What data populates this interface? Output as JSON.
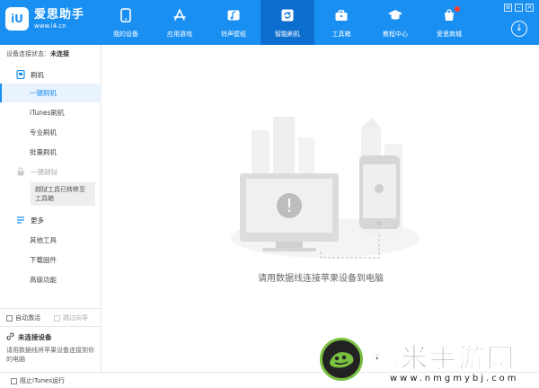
{
  "app": {
    "logo_text": "iU",
    "name": "爱思助手",
    "url": "www.i4.cn"
  },
  "nav": {
    "items": [
      {
        "label": "我的设备",
        "icon": "phone-icon"
      },
      {
        "label": "应用游戏",
        "icon": "app-store-icon"
      },
      {
        "label": "铃声壁纸",
        "icon": "ringtone-wallpaper-icon"
      },
      {
        "label": "智能刷机",
        "icon": "flash-icon",
        "active": true
      },
      {
        "label": "工具箱",
        "icon": "toolbox-icon"
      },
      {
        "label": "教程中心",
        "icon": "graduation-cap-icon"
      },
      {
        "label": "爱思商城",
        "icon": "store-icon",
        "badge": true
      }
    ]
  },
  "window": {
    "menu_glyph": "≡",
    "minimize_glyph": "–",
    "close_glyph": "×",
    "download_glyph": "↓"
  },
  "sidebar": {
    "status_label": "设备连接状态：",
    "status_value": "未连接",
    "flash_section": "刷机",
    "flash_items": [
      "一键刷机",
      "iTunes刷机",
      "专业刷机",
      "批量刷机"
    ],
    "jailbreak_section": "一键越狱",
    "jailbreak_notice": "越狱工具已转移至工具箱",
    "more_section": "更多",
    "more_items": [
      "其他工具",
      "下载固件",
      "高级功能"
    ],
    "auto_activate": "自动激活",
    "skip_guide": "跳过向导",
    "device_title": "未连接设备",
    "device_desc": "请用数据线将苹果设备连接到你的电脑"
  },
  "main": {
    "message": "请用数据线连接苹果设备到电脑",
    "alert_glyph": "!"
  },
  "footer": {
    "block_itunes": "阻止iTunes运行"
  },
  "watermark": {
    "title": "糯米手游网",
    "url": "www.nmgmybj.com"
  },
  "colors": {
    "brand": "#1a8ff2",
    "nav_active": "#0c6fcf",
    "sidebar_active_bg": "#e9f3fd"
  }
}
